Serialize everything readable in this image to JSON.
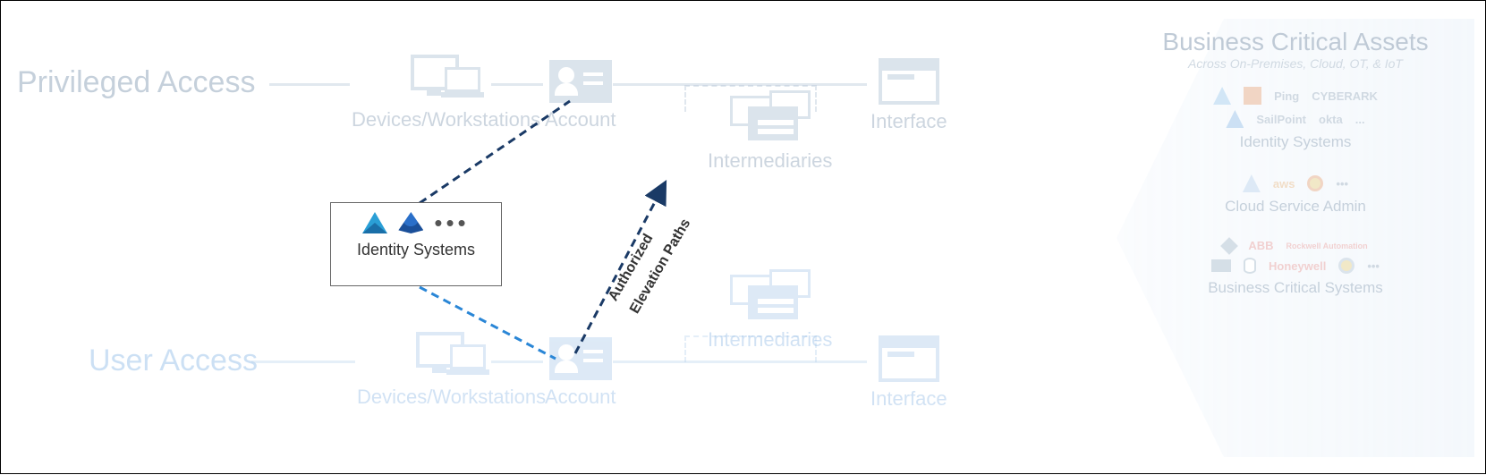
{
  "lanes": {
    "privileged": {
      "title": "Privileged Access",
      "nodes": {
        "devices": "Devices/Workstations",
        "account": "Account",
        "intermediaries": "Intermediaries",
        "interface": "Interface"
      }
    },
    "user": {
      "title": "User Access",
      "nodes": {
        "devices": "Devices/Workstations",
        "account": "Account",
        "intermediaries": "Intermediaries",
        "interface": "Interface"
      }
    }
  },
  "center_box": {
    "label": "Identity Systems",
    "more": "•••"
  },
  "elevation_label_1": "Authorized",
  "elevation_label_2": "Elevation Paths",
  "right_panel": {
    "heading": "Business Critical Assets",
    "subheading": "Across On-Premises, Cloud, OT, & IoT",
    "groups": [
      {
        "title": "Identity Systems",
        "logos": [
          "",
          "Ping",
          "CYBERARK",
          "",
          "SailPoint",
          "okta",
          "..."
        ]
      },
      {
        "title": "Cloud Service Admin",
        "logos": [
          "",
          "aws",
          "",
          "•••"
        ]
      },
      {
        "title": "Business Critical Systems",
        "logos": [
          "",
          "ABB",
          "Rockwell Automation",
          "",
          "",
          "Honeywell",
          "",
          "•••"
        ]
      }
    ]
  }
}
